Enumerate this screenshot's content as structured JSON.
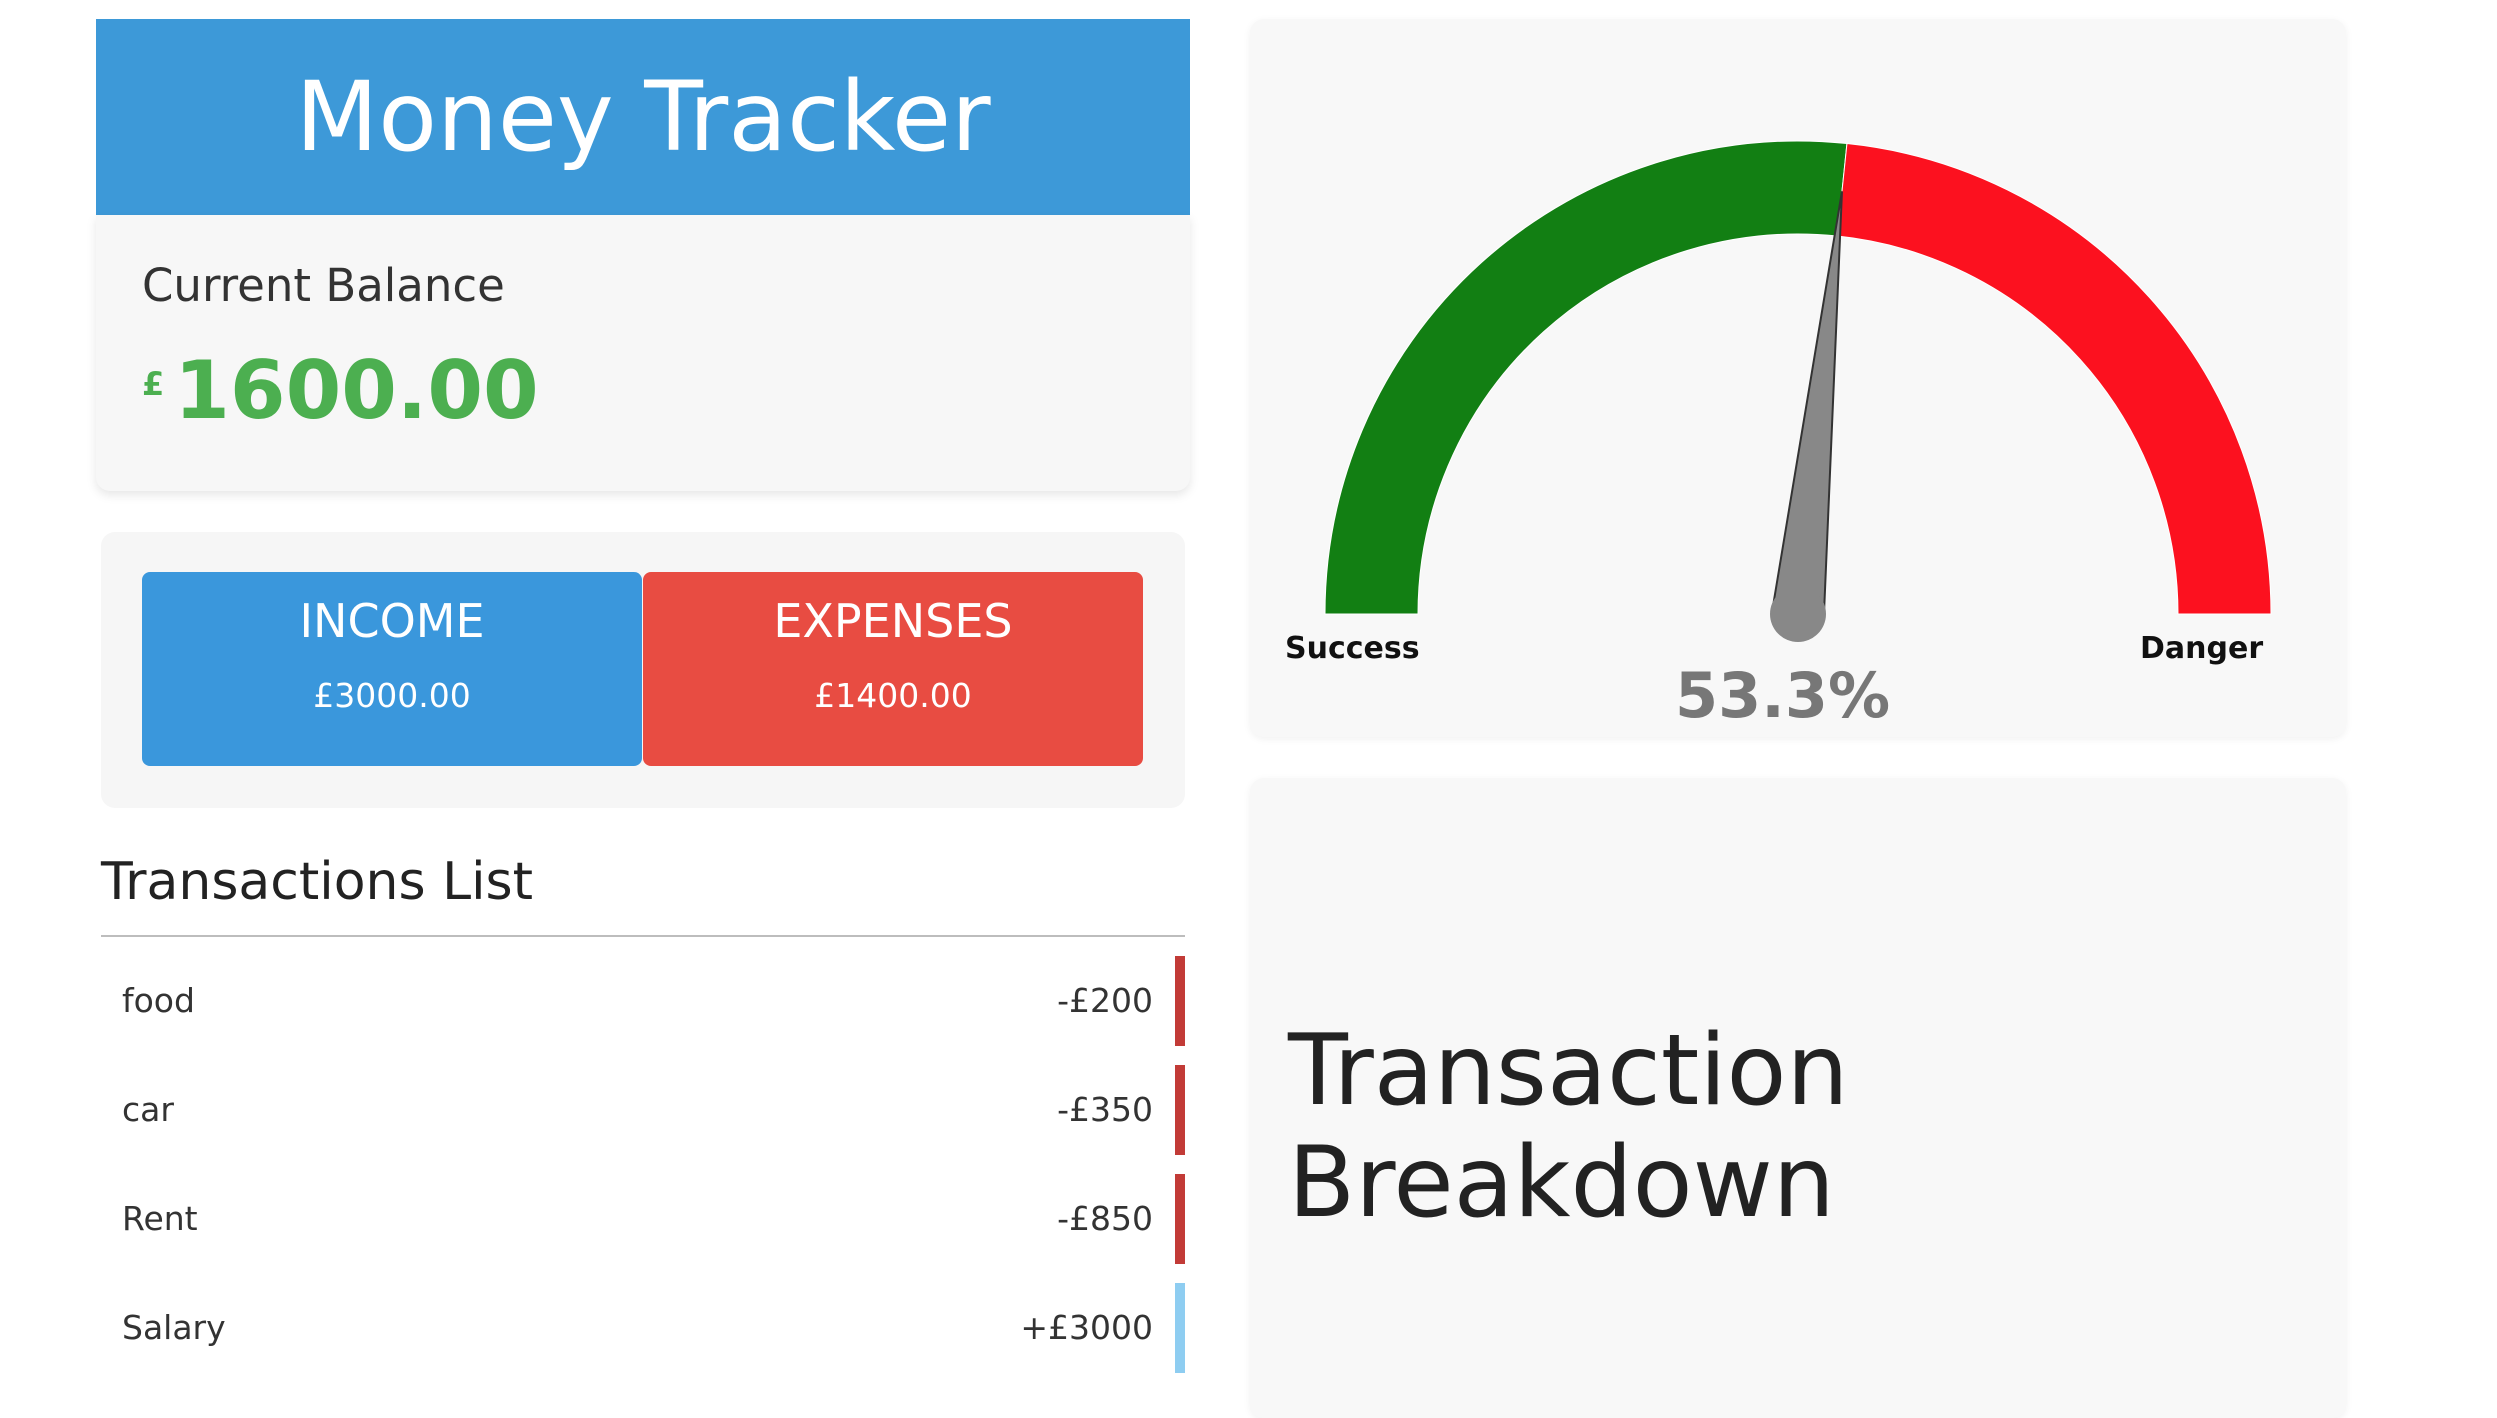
{
  "header": {
    "title": "Money Tracker"
  },
  "balance": {
    "label": "Current Balance",
    "currency": "£",
    "amount": "1600.00",
    "color": "#4caf50"
  },
  "summary": {
    "income": {
      "label": "INCOME",
      "amount": "£3000.00",
      "color": "#3a97dc"
    },
    "expenses": {
      "label": "EXPENSES",
      "amount": "£1400.00",
      "color": "#e84c42"
    }
  },
  "transactions": {
    "heading": "Transactions List",
    "items": [
      {
        "name": "food",
        "amount": "-£200",
        "type": "expense"
      },
      {
        "name": "car",
        "amount": "-£350",
        "type": "expense"
      },
      {
        "name": "Rent",
        "amount": "-£850",
        "type": "expense"
      },
      {
        "name": "Salary",
        "amount": "+£3000",
        "type": "income"
      }
    ],
    "expense_color": "#c23b37",
    "income_color": "#8ecdf1"
  },
  "gauge": {
    "left_label": "Success",
    "right_label": "Danger",
    "percent_text": "53.3%",
    "value": 53.3,
    "success_color": "#127f13",
    "danger_color": "#fc111f",
    "needle_color": "#888888"
  },
  "breakdown": {
    "title": "Transaction Breakdown"
  }
}
